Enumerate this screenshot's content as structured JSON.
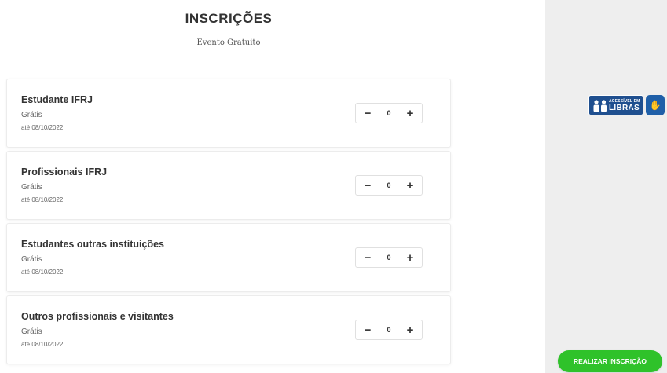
{
  "header": {
    "title": "INSCRIÇÕES",
    "subtitle": "Evento Gratuito"
  },
  "tickets": [
    {
      "name": "Estudante IFRJ",
      "price": "Grátis",
      "deadline": "até 08/10/2022",
      "quantity": "0"
    },
    {
      "name": "Profissionais IFRJ",
      "price": "Grátis",
      "deadline": "até 08/10/2022",
      "quantity": "0"
    },
    {
      "name": "Estudantes outras instituições",
      "price": "Grátis",
      "deadline": "até 08/10/2022",
      "quantity": "0"
    },
    {
      "name": "Outros profissionais e visitantes",
      "price": "Grátis",
      "deadline": "até 08/10/2022",
      "quantity": "0"
    }
  ],
  "stepper": {
    "minus": "−",
    "plus": "+"
  },
  "accessibility": {
    "badge_small": "ACESSÍVEL EM",
    "badge_big": "LIBRAS",
    "hand_icon": "hand-icon",
    "badge_color": "#1f4f8f"
  },
  "cta": {
    "label": "REALIZAR INSCRIÇÃO",
    "color": "#2fc22a"
  }
}
